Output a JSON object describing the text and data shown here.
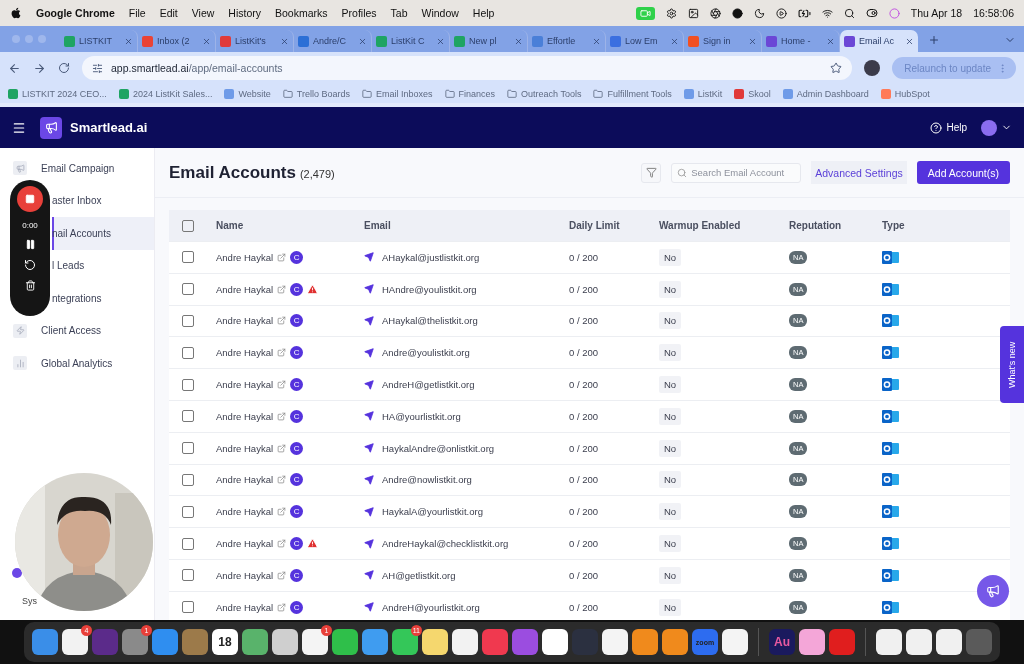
{
  "menu_bar": {
    "app": "Google Chrome",
    "menus": [
      "File",
      "Edit",
      "View",
      "History",
      "Bookmarks",
      "Profiles",
      "Tab",
      "Window",
      "Help"
    ],
    "date": "Thu Apr 18",
    "time": "16:58:06"
  },
  "browser": {
    "tabs": [
      {
        "title": "LISTKIT",
        "color": "#1fa463",
        "selected": false
      },
      {
        "title": "Inbox (2",
        "color": "#ea4335",
        "selected": false
      },
      {
        "title": "ListKit's",
        "color": "#e03a3a",
        "selected": false
      },
      {
        "title": "Andre/C",
        "color": "#2c6fd6",
        "selected": false
      },
      {
        "title": "ListKit C",
        "color": "#1fa463",
        "selected": false
      },
      {
        "title": "New pl",
        "color": "#1fa463",
        "selected": false
      },
      {
        "title": "Effortle",
        "color": "#4a7fd8",
        "selected": false
      },
      {
        "title": "Low Em",
        "color": "#3b6fe0",
        "selected": false
      },
      {
        "title": "Sign in",
        "color": "#f25022",
        "selected": false
      },
      {
        "title": "Home -",
        "color": "#6b47d6",
        "selected": false
      },
      {
        "title": "Email Ac",
        "color": "#6b47d6",
        "selected": true
      }
    ],
    "url_host": "app.smartlead.ai",
    "url_path": "/app/email-accounts",
    "relaunch": "Relaunch to update",
    "bookmarks": [
      {
        "label": "LISTKIT 2024 CEO...",
        "kind": "site",
        "color": "#1fa463"
      },
      {
        "label": "2024 ListKit Sales...",
        "kind": "site",
        "color": "#1fa463"
      },
      {
        "label": "Website",
        "kind": "site",
        "color": "#6f9be8"
      },
      {
        "label": "Trello Boards",
        "kind": "folder"
      },
      {
        "label": "Email Inboxes",
        "kind": "folder"
      },
      {
        "label": "Finances",
        "kind": "folder"
      },
      {
        "label": "Outreach Tools",
        "kind": "folder"
      },
      {
        "label": "Fulfillment Tools",
        "kind": "folder"
      },
      {
        "label": "ListKit",
        "kind": "site",
        "color": "#6f9be8"
      },
      {
        "label": "Skool",
        "kind": "site",
        "color": "#e03a3a"
      },
      {
        "label": "Admin Dashboard",
        "kind": "site",
        "color": "#6f9be8"
      },
      {
        "label": "HubSpot",
        "kind": "site",
        "color": "#ff7a59"
      }
    ]
  },
  "app": {
    "brand": "Smartlead.ai",
    "help": "Help",
    "sidebar": {
      "items": [
        {
          "label": "Email Campaign",
          "selected": false,
          "covered": false
        },
        {
          "label": "aster Inbox",
          "selected": false,
          "covered": true
        },
        {
          "label": "nail Accounts",
          "selected": true,
          "covered": true
        },
        {
          "label": "l Leads",
          "selected": false,
          "covered": true
        },
        {
          "label": "ntegrations",
          "selected": false,
          "covered": true
        },
        {
          "label": "Client Access",
          "selected": false,
          "covered": false
        },
        {
          "label": "Global Analytics",
          "selected": false,
          "covered": false
        }
      ],
      "footer": "Sys"
    },
    "page": {
      "title": "Email Accounts",
      "count": "(2,479)",
      "search_placeholder": "Search Email Account",
      "advanced": "Advanced Settings",
      "add": "Add Account(s)"
    },
    "table": {
      "header_checked": false,
      "columns": [
        "Name",
        "Email",
        "Daily Limit",
        "Warmup Enabled",
        "Reputation",
        "Type"
      ],
      "rows": [
        {
          "checked": false,
          "name": "Andre Haykal",
          "badge": "C",
          "warning": false,
          "email": "AHaykal@justlistkit.org",
          "limit": "0 / 200",
          "warmup": "No",
          "reputation": "NA"
        },
        {
          "checked": false,
          "name": "Andre Haykal",
          "badge": "C",
          "warning": true,
          "email": "HAndre@youlistkit.org",
          "limit": "0 / 200",
          "warmup": "No",
          "reputation": "NA"
        },
        {
          "checked": false,
          "name": "Andre Haykal",
          "badge": "C",
          "warning": false,
          "email": "AHaykal@thelistkit.org",
          "limit": "0 / 200",
          "warmup": "No",
          "reputation": "NA"
        },
        {
          "checked": false,
          "name": "Andre Haykal",
          "badge": "C",
          "warning": false,
          "email": "Andre@youlistkit.org",
          "limit": "0 / 200",
          "warmup": "No",
          "reputation": "NA"
        },
        {
          "checked": false,
          "name": "Andre Haykal",
          "badge": "C",
          "warning": false,
          "email": "AndreH@getlistkit.org",
          "limit": "0 / 200",
          "warmup": "No",
          "reputation": "NA"
        },
        {
          "checked": false,
          "name": "Andre Haykal",
          "badge": "C",
          "warning": false,
          "email": "HA@yourlistkit.org",
          "limit": "0 / 200",
          "warmup": "No",
          "reputation": "NA"
        },
        {
          "checked": false,
          "name": "Andre Haykal",
          "badge": "C",
          "warning": false,
          "email": "HaykalAndre@onlistkit.org",
          "limit": "0 / 200",
          "warmup": "No",
          "reputation": "NA"
        },
        {
          "checked": false,
          "name": "Andre Haykal",
          "badge": "C",
          "warning": false,
          "email": "Andre@nowlistkit.org",
          "limit": "0 / 200",
          "warmup": "No",
          "reputation": "NA"
        },
        {
          "checked": false,
          "name": "Andre Haykal",
          "badge": "C",
          "warning": false,
          "email": "HaykalA@yourlistkit.org",
          "limit": "0 / 200",
          "warmup": "No",
          "reputation": "NA"
        },
        {
          "checked": false,
          "name": "Andre Haykal",
          "badge": "C",
          "warning": true,
          "email": "AndreHaykal@checklistkit.org",
          "limit": "0 / 200",
          "warmup": "No",
          "reputation": "NA"
        },
        {
          "checked": false,
          "name": "Andre Haykal",
          "badge": "C",
          "warning": false,
          "email": "AH@getlistkit.org",
          "limit": "0 / 200",
          "warmup": "No",
          "reputation": "NA"
        },
        {
          "checked": false,
          "name": "Andre Haykal",
          "badge": "C",
          "warning": false,
          "email": "AndreH@yourlistkit.org",
          "limit": "0 / 200",
          "warmup": "No",
          "reputation": "NA"
        }
      ]
    },
    "whats_new": "What's new"
  },
  "recorder": {
    "time": "0:00"
  },
  "dock": {
    "groups": [
      [
        {
          "color": "#3a8ee8"
        },
        {
          "color": "#f2f2f2",
          "badge": "4"
        },
        {
          "color": "#5b2b8a"
        },
        {
          "color": "#8a8a8a",
          "badge": "1"
        },
        {
          "color": "#2f8ef0"
        },
        {
          "color": "#9c7a4a"
        },
        {
          "color": "#ffffff",
          "label": "18"
        },
        {
          "color": "#59b36b"
        },
        {
          "color": "#cfcfcf"
        },
        {
          "color": "#f4f4f4",
          "badge": "1"
        },
        {
          "color": "#2fbf4a"
        },
        {
          "color": "#3f9cf0"
        },
        {
          "color": "#34c759",
          "badge": "11"
        },
        {
          "color": "#f5d76e"
        },
        {
          "color": "#f2f2f2"
        },
        {
          "color": "#f0394f"
        },
        {
          "color": "#9b4de0"
        },
        {
          "color": "#ffffff"
        },
        {
          "color": "#2b3040"
        },
        {
          "color": "#f4f4f4"
        },
        {
          "color": "#f08a1c"
        },
        {
          "color": "#f08a1c"
        },
        {
          "color": "#2d6cf0",
          "label": "zoom"
        },
        {
          "color": "#f4f4f4"
        }
      ],
      [
        {
          "color": "#1a1a5e",
          "label": "Au"
        },
        {
          "color": "#f4a6d8"
        },
        {
          "color": "#e01e1e"
        }
      ],
      [
        {
          "color": "#f0f0f0"
        },
        {
          "color": "#f0f0f0"
        },
        {
          "color": "#f0f0f0"
        },
        {
          "color": "#5a5a5a"
        }
      ]
    ]
  }
}
